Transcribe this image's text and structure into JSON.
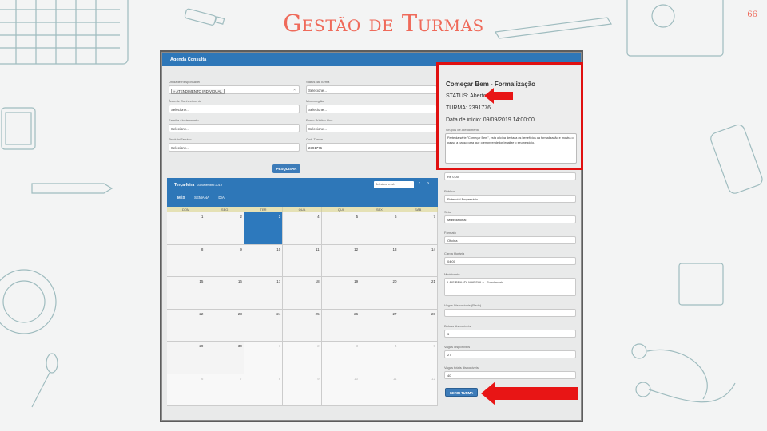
{
  "slide": {
    "title": "Gestão de Turmas",
    "page_number": "66"
  },
  "app": {
    "header": "Agenda Consulta",
    "form": {
      "unidade": {
        "label": "Unidade Responsável",
        "value": "» ATENDIMENTO INDIVIDUAL"
      },
      "status_turma": {
        "label": "Status da Turma",
        "value": "Selecione..."
      },
      "area": {
        "label": "Área de Conhecimento",
        "value": "Selecione..."
      },
      "microrregiao": {
        "label": "Microrregião",
        "value": "Selecione..."
      },
      "familia": {
        "label": "Família / Instrumento",
        "value": "Selecione..."
      },
      "ponto": {
        "label": "Ponto Público Alvo",
        "value": "Selecione..."
      },
      "produto": {
        "label": "Produto/Serviço",
        "value": "Selecione..."
      },
      "cod_turma": {
        "label": "Cod. Turma",
        "value": "2391776"
      },
      "search_button": "PESQUISAR"
    },
    "calendar": {
      "day_label": "Terça-feira",
      "date_label": "03 Setembro 2019",
      "select_placeholder": "Selecione o mês",
      "prev": "‹",
      "next": "›",
      "tabs": [
        "MÊS",
        "SEMANA",
        "DIA"
      ],
      "weekdays": [
        "DOM",
        "SEG",
        "TER",
        "QUA",
        "QUI",
        "SEX",
        "SÁB"
      ],
      "weeks": [
        [
          "1",
          "2",
          "3",
          "4",
          "5",
          "6",
          "7"
        ],
        [
          "8",
          "9",
          "10",
          "11",
          "12",
          "13",
          "14"
        ],
        [
          "15",
          "16",
          "17",
          "18",
          "19",
          "20",
          "21"
        ],
        [
          "22",
          "23",
          "24",
          "25",
          "26",
          "27",
          "28"
        ],
        [
          "29",
          "30",
          "1",
          "2",
          "3",
          "4",
          "5"
        ],
        [
          "6",
          "7",
          "8",
          "9",
          "10",
          "11",
          "12"
        ]
      ]
    },
    "details": {
      "title": "Começar Bem - Formalização",
      "status": "STATUS: Aberto",
      "turma": "TURMA: 2391776",
      "data_inicio": "Data de início: 09/09/2019 14:00:00",
      "descricao_label": "Grupos de Atendimento",
      "descricao": "Parte da série \"Começar Bem\", esta oficina destaca os benefícios da formalização e mostra o passo a passo para que o empreendedor legalize o seu negócio.",
      "valor": {
        "label": "Valor",
        "value": "R$ 0,00"
      },
      "publico": {
        "label": "Público",
        "value": "Potencial Empresário"
      },
      "setor": {
        "label": "Setor",
        "value": "Multissetorial"
      },
      "formato": {
        "label": "Formato",
        "value": "Oficina"
      },
      "carga": {
        "label": "Carga Horária",
        "value": "04:00"
      },
      "ministrante": {
        "label": "Ministrante",
        "value": "LAIS RENATA MARSOLA - Funcionário"
      },
      "vagas_disp_rede": {
        "label": "Vagas Disponíveis (Rede)",
        "value": ""
      },
      "bolsas": {
        "label": "Bolsas disponíveis",
        "value": "3"
      },
      "vagas_disp": {
        "label": "Vagas disponíveis",
        "value": "27"
      },
      "vagas_totais": {
        "label": "Vagas totais disponíveis",
        "value": "40"
      },
      "gerir_button": "GERIR TURMA"
    }
  },
  "colors": {
    "title": "#ef6a5a",
    "header_blue": "#2e77b8",
    "highlight_red": "#e01010",
    "arrow_red": "#e81515"
  }
}
